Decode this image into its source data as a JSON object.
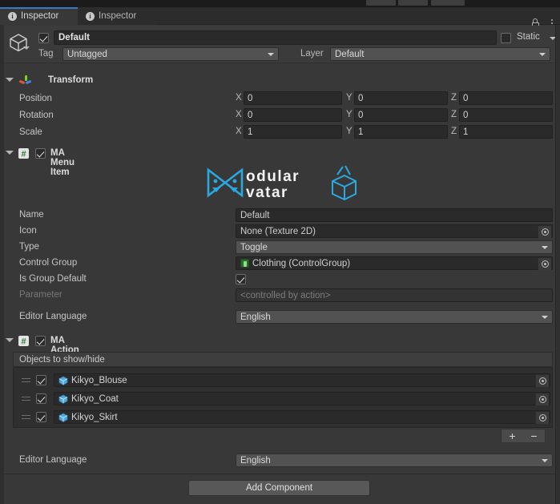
{
  "window": {
    "tabs": [
      {
        "label": "Inspector",
        "icon": "info-icon",
        "active": true
      },
      {
        "label": "Inspector",
        "icon": "info-icon",
        "active": false
      }
    ],
    "lock_icon": "lock-icon",
    "menu_icon": "kebab-menu-icon"
  },
  "gameobject": {
    "enabled_checkbox": true,
    "name": "Default",
    "prefab_icon": "cube-icon",
    "static_label": "Static",
    "static_checkbox": false,
    "tag_label": "Tag",
    "tag_value": "Untagged",
    "layer_label": "Layer",
    "layer_value": "Default"
  },
  "transform": {
    "title": "Transform",
    "icon": "transform-axis-icon",
    "help_icon": "help-icon",
    "preset_icon": "preset-icon",
    "menu_icon": "kebab-menu-icon",
    "rows": [
      {
        "label": "Position",
        "x": "0",
        "y": "0",
        "z": "0"
      },
      {
        "label": "Rotation",
        "x": "0",
        "y": "0",
        "z": "0"
      },
      {
        "label": "Scale",
        "x": "1",
        "y": "1",
        "z": "1"
      }
    ],
    "axis_labels": [
      "X",
      "Y",
      "Z"
    ]
  },
  "menu_item": {
    "title": "MA Menu Item",
    "icon": "script-icon",
    "enabled_checkbox": true,
    "help_icon": "help-icon",
    "preset_icon": "preset-icon",
    "menu_icon": "kebab-menu-icon",
    "logo": {
      "line1": "odular",
      "line2": "vatar",
      "mark": "modular-avatar-logo",
      "accent_color": "#29a9e0"
    },
    "fields": {
      "name_label": "Name",
      "name_value": "Default",
      "icon_label": "Icon",
      "icon_value": "None (Texture 2D)",
      "type_label": "Type",
      "type_value": "Toggle",
      "control_group_label": "Control Group",
      "control_group_value": "Clothing (ControlGroup)",
      "is_group_default_label": "Is Group Default",
      "is_group_default_value": true,
      "parameter_label": "Parameter",
      "parameter_value": "<controlled by action>",
      "editor_language_label": "Editor Language",
      "editor_language_value": "English"
    }
  },
  "action_toggle": {
    "title": "MA Action Toggle Object",
    "icon": "script-icon",
    "enabled_checkbox": true,
    "help_icon": "help-icon",
    "preset_icon": "preset-icon",
    "menu_icon": "kebab-menu-icon",
    "list_header": "Objects to show/hide",
    "items": [
      {
        "checked": true,
        "name": "Kikyo_Blouse",
        "icon": "gameobject-cube-icon"
      },
      {
        "checked": true,
        "name": "Kikyo_Coat",
        "icon": "gameobject-cube-icon"
      },
      {
        "checked": true,
        "name": "Kikyo_Skirt",
        "icon": "gameobject-cube-icon"
      }
    ],
    "add_button": "+",
    "remove_button": "−",
    "editor_language_label": "Editor Language",
    "editor_language_value": "English"
  },
  "footer": {
    "add_component_label": "Add Component"
  },
  "colors": {
    "accent_blue": "#3a79c8",
    "logo_cyan": "#29a9e0",
    "panel_bg": "#383838",
    "header_bg": "#424242"
  }
}
